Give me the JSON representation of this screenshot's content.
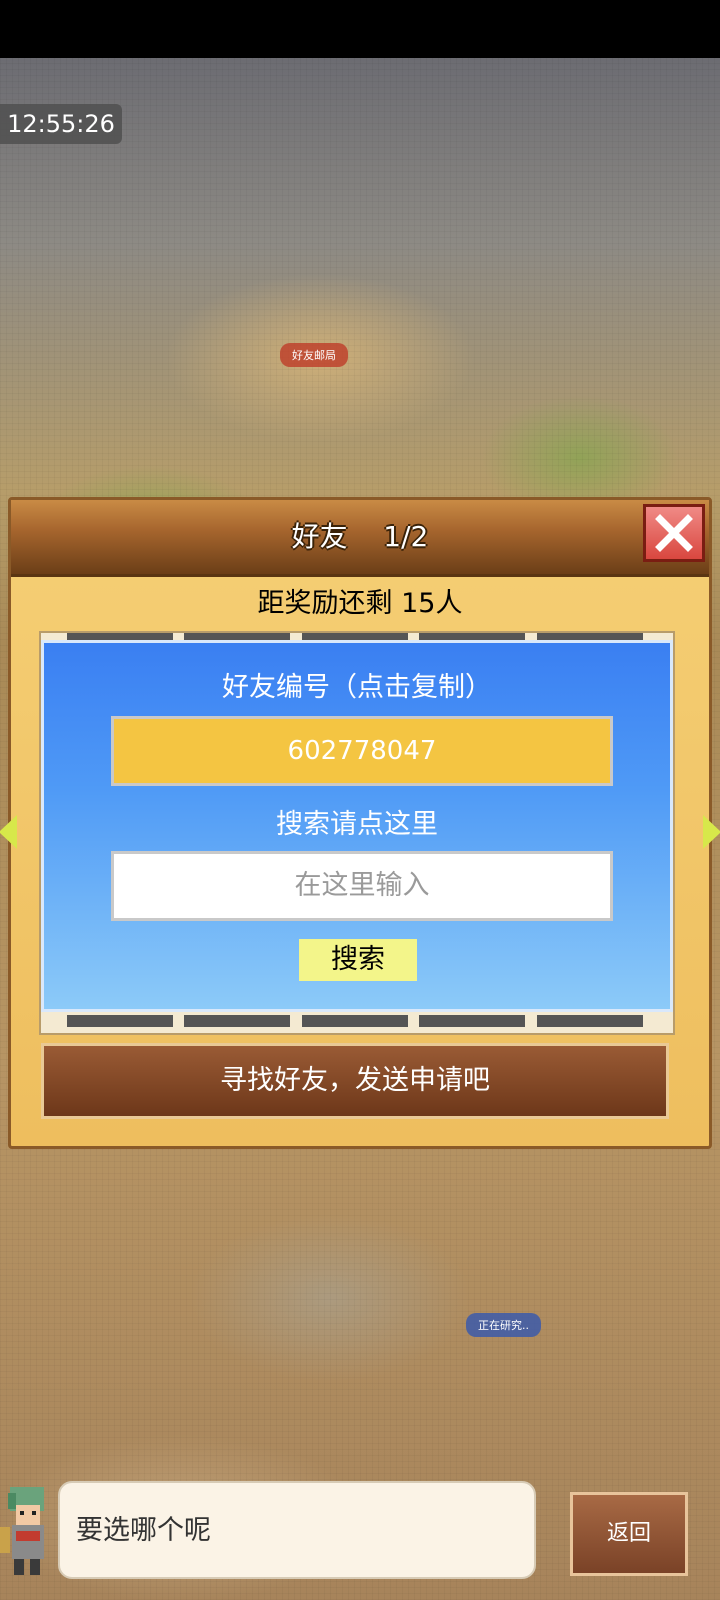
{
  "clock": "12:55:26",
  "map": {
    "labels": [
      "好友邮局",
      "正在研究.."
    ]
  },
  "dialog": {
    "title": "好友",
    "page": "1/2",
    "reward_text": "距奖励还剩 15人",
    "friend_id_label": "好友编号（点击复制）",
    "friend_id": "602778047",
    "search_hint": "搜索请点这里",
    "search_placeholder": "在这里输入",
    "search_button": "搜索",
    "find_button": "寻找好友，发送申请吧"
  },
  "bottom": {
    "speech": "要选哪个呢",
    "back_button": "返回"
  },
  "colors": {
    "panel_blue": "#3a7ff2",
    "friend_id_bg": "#f4c542",
    "search_button_bg": "#f3f58a",
    "close_red": "#d9473f"
  }
}
